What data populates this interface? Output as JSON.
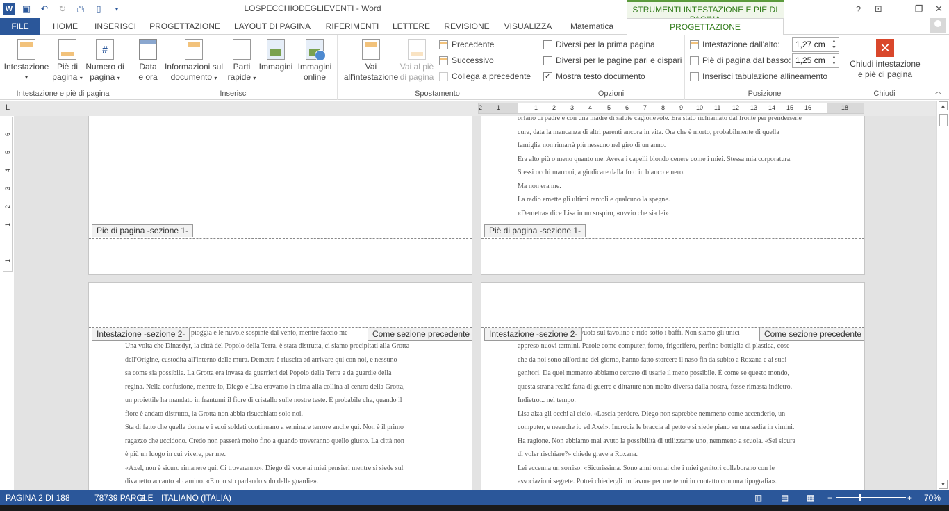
{
  "app": {
    "doc_title": "LOSPECCHIODEGLIEVENTI - Word",
    "context_tab_header": "STRUMENTI INTESTAZIONE E PIÈ DI PAGINA",
    "help": "?",
    "accent_color": "#2b579a",
    "context_color": "#5b9a3c"
  },
  "tabs": [
    "FILE",
    "HOME",
    "INSERISCI",
    "PROGETTAZIONE",
    "LAYOUT DI PAGINA",
    "RIFERIMENTI",
    "LETTERE",
    "REVISIONE",
    "VISUALIZZA",
    "Matematica",
    "PROGETTAZIONE"
  ],
  "ribbon": {
    "group1": {
      "label": "Intestazione e piè di pagina",
      "intestazione": "Intestazione",
      "pie_1": "Piè di",
      "pie_2": "pagina",
      "numero_1": "Numero di",
      "numero_2": "pagina"
    },
    "group2": {
      "label": "Inserisci",
      "data_1": "Data",
      "data_2": "e ora",
      "info_1": "Informazioni sul",
      "info_2": "documento",
      "parti_1": "Parti",
      "parti_2": "rapide",
      "immagini": "Immagini",
      "online_1": "Immagini",
      "online_2": "online"
    },
    "group3": {
      "label": "Spostamento",
      "vai_int_1": "Vai",
      "vai_int_2": "all'intestazione",
      "vai_pie_1": "Vai al piè",
      "vai_pie_2": "di pagina",
      "precedente": "Precedente",
      "successivo": "Successivo",
      "collega": "Collega a precedente"
    },
    "group4": {
      "label": "Opzioni",
      "opt1": "Diversi per la prima pagina",
      "opt2": "Diversi per le pagine pari e dispari",
      "opt3": "Mostra testo documento",
      "opt3_check": "✓"
    },
    "group5": {
      "label": "Posizione",
      "int_alto_label": "Intestazione dall'alto:",
      "int_alto_value": "1,27 cm",
      "pie_basso_label": "Piè di pagina dal basso:",
      "pie_basso_value": "1,25 cm",
      "tabulazione": "Inserisci tabulazione allineamento"
    },
    "group6": {
      "label": "Chiudi",
      "close_icon": "✕",
      "chiudi_1": "Chiudi intestazione",
      "chiudi_2": "e piè di pagina"
    }
  },
  "ruler": {
    "corner": "L",
    "h_ticks": [
      "2",
      "1",
      "1",
      "2",
      "3",
      "4",
      "5",
      "6",
      "7",
      "8",
      "9",
      "10",
      "11",
      "12",
      "13",
      "14",
      "15",
      "16",
      "18"
    ],
    "v_ticks": [
      "6",
      "5",
      "4",
      "3",
      "2",
      "1",
      "1"
    ]
  },
  "labels": {
    "footer_s1": "Piè di pagina -sezione 1-",
    "header_s2": "Intestazione -sezione 2-",
    "same_as_prev": "Come sezione precedente"
  },
  "pages": {
    "top_right": [
      "orfano di padre e con una madre di salute cagionevole. Era stato richiamato dal fronte per prendersene",
      "cura, data la mancanza di altri parenti ancora in vita. Ora che è morto, probabilmente di quella",
      "famiglia non rimarrà più nessuno nel giro di un anno.",
      "   Era alto più o meno quanto me. Aveva i capelli biondo cenere come i miei. Stessa mia corporatura.",
      "Stessi occhi marroni, a giudicare dalla foto in bianco e nero.",
      "   Ma non era me.",
      "   La radio emette gli ultimi rantoli e qualcuno la spegne.",
      "   «Demetra» dice Lisa in un sospiro, «ovvio che sia lei»"
    ],
    "bottom_left_partial": "a pioggia e le nuvole sospinte dal vento, mentre faccio me",
    "bottom_left": [
      "Una volta che Dinasdyr, la città del Popolo della Terra, è stata distrutta, ci siamo precipitati alla Grotta",
      "dell'Origine, custodita all'interno delle mura. Demetra è riuscita ad arrivare qui con noi, e nessuno",
      "sa come sia possibile. La Grotta era invasa da guerrieri del Popolo della Terra e da guardie della",
      "regina. Nella confusione, mentre io, Diego e Lisa eravamo in cima alla collina al centro della Grotta,",
      "un proiettile ha mandato in frantumi il fiore di cristallo sulle nostre teste. È probabile che, quando il",
      "fiore è andato distrutto, la Grotta non abbia risucchiato solo noi.",
      "   Sta di fatto che quella donna e i suoi soldati continuano a seminare terrore anche qui. Non è il primo",
      "ragazzo che uccidono. Credo non passerà molto fino a quando troveranno quello giusto. La città non",
      "è più un luogo in cui vivere, per me.",
      "   «Axel, non è sicuro rimanere qui. Ci troveranno». Diego dà voce ai miei pensieri mentre si siede sul",
      "divanetto accanto al camino. «E non sto parlando solo delle guardie»."
    ],
    "bottom_right_partial": "vuota sul tavolino e rido sotto i baffi. Non siamo gli unici",
    "bottom_right": [
      "appreso nuovi termini. Parole come computer, forno, frigorifero, perfino bottiglia di plastica, cose",
      "che da noi sono all'ordine del giorno, hanno fatto storcere il naso fin da subito a Roxana e ai suoi",
      "genitori. Da quel momento abbiamo cercato di usarle il meno possibile. È come se questo mondo,",
      "questa strana realtà fatta di guerre e dittature non molto diversa dalla nostra, fosse rimasta indietro.",
      "Indietro... nel tempo.",
      "   Lisa alza gli occhi al cielo. «Lascia perdere. Diego non saprebbe nemmeno come accenderlo, un",
      "computer, e neanche io ed Axel». Incrocia le braccia al petto e si siede piano su una sedia in vimini.",
      "Ha ragione. Non abbiamo mai avuto la possibilità di utilizzarne uno, nemmeno a scuola. «Sei sicura",
      "di voler rischiare?» chiede grave a Roxana.",
      "   Lei accenna un sorriso. «Sicurissima. Sono anni ormai che i miei genitori collaborano con le",
      "associazioni segrete. Potrei chiedergli un favore per mettermi in contatto con una tipografia»."
    ]
  },
  "status": {
    "page": "PAGINA 2 DI 188",
    "words": "78739 PAROLE",
    "language": "ITALIANO (ITALIA)",
    "zoom": "70%",
    "zoom_level": 0.7
  }
}
